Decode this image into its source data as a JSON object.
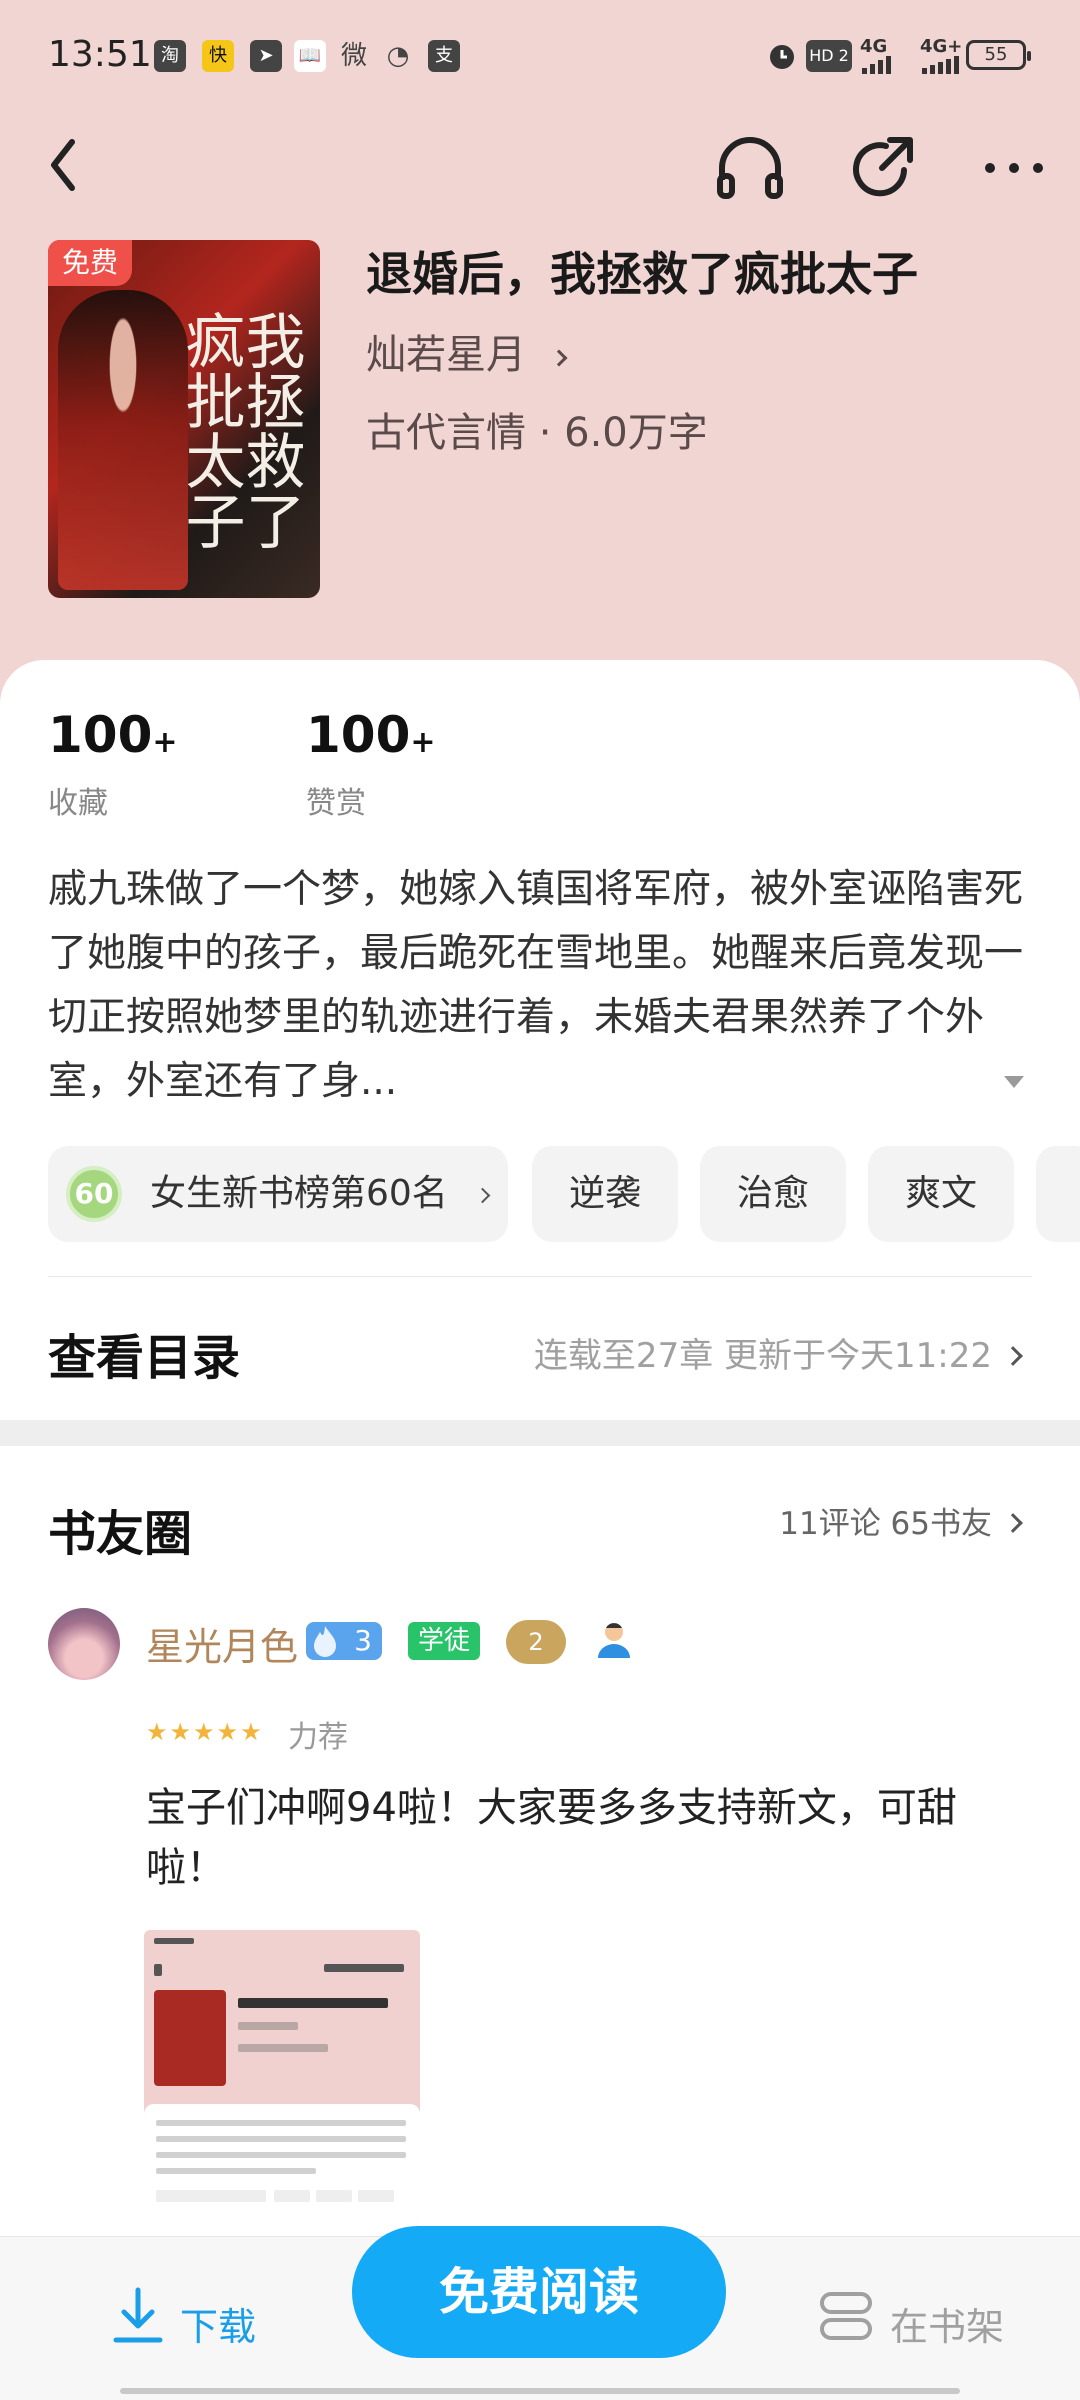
{
  "status_bar": {
    "time": "13:51",
    "app_icons": [
      "淘",
      "快",
      "➤",
      "📖",
      "微",
      "◔",
      "支"
    ],
    "network": "HD 2",
    "signal1": "4G",
    "signal2": "4G+",
    "battery": "55"
  },
  "nav": {
    "icons": [
      "back-icon",
      "headphones-icon",
      "share-icon",
      "more-icon"
    ]
  },
  "book": {
    "free_badge": "免费",
    "cover_title": "我拯救了疯批太子",
    "title": "退婚后，我拯救了疯批太子",
    "author": "灿若星月",
    "meta": "古代言情 · 6.0万字"
  },
  "stats": [
    {
      "value": "100",
      "suffix": "+",
      "label": "收藏"
    },
    {
      "value": "100",
      "suffix": "+",
      "label": "赞赏"
    }
  ],
  "synopsis": "戚九珠做了一个梦，她嫁入镇国将军府，被外室诬陷害死了她腹中的孩子，最后跪死在雪地里。她醒来后竟发现一切正按照她梦里的轨迹进行着，未婚夫君果然养了个外室，外室还有了身...",
  "tags": {
    "rank_number": "60",
    "rank_label": "女生新书榜第60名",
    "items": [
      "逆袭",
      "治愈",
      "爽文"
    ]
  },
  "toc": {
    "title": "查看目录",
    "meta": "连载至27章    更新于今天11:22"
  },
  "circle": {
    "title": "书友圈",
    "meta": "11评论 65书友",
    "comment": {
      "user": "星光月色",
      "fire_level": "3",
      "learner_badge": "学徒",
      "level_badge": "2",
      "stars": "★★★★★",
      "recommend": "力荐",
      "text": "宝子们冲啊94啦！大家要多多支持新文，可甜啦！"
    }
  },
  "bottom_bar": {
    "download": "下载",
    "read": "免费阅读",
    "shelf": "在书架"
  },
  "colors": {
    "header_bg": "#f1d5d3",
    "primary_blue": "#14aaf5",
    "free_red": "#f0504a"
  }
}
